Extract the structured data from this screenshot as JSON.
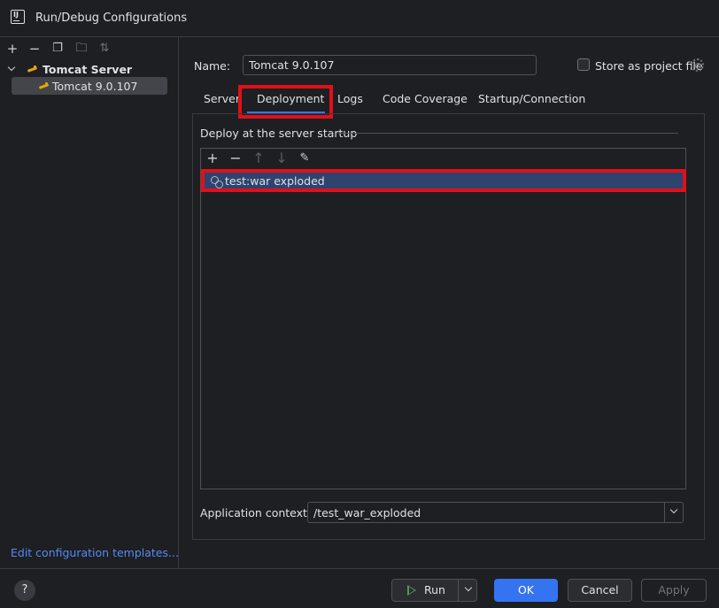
{
  "window": {
    "title": "Run/Debug Configurations",
    "icon": "intellij-app-icon"
  },
  "sidebar": {
    "toolbar": [
      {
        "icon": "plus-icon",
        "glyph": "+"
      },
      {
        "icon": "minus-icon",
        "glyph": "−"
      },
      {
        "icon": "copy-icon",
        "glyph": "❐"
      },
      {
        "icon": "folder-add-icon",
        "glyph": "🗀"
      },
      {
        "icon": "sort-icon",
        "glyph": "⇅"
      }
    ],
    "group_label": "Tomcat Server",
    "item_label": "Tomcat 9.0.107",
    "edit_templates_link": "Edit configuration templates..."
  },
  "form": {
    "name_label": "Name:",
    "name_value": "Tomcat 9.0.107",
    "store_label": "Store as project file",
    "store_checked": false
  },
  "tabs": [
    {
      "label": "Server",
      "active": false
    },
    {
      "label": "Deployment",
      "active": true
    },
    {
      "label": "Logs",
      "active": false
    },
    {
      "label": "Code Coverage",
      "active": false
    },
    {
      "label": "Startup/Connection",
      "active": false
    }
  ],
  "deployment": {
    "section_title": "Deploy at the server startup",
    "list_toolbar": [
      {
        "icon": "plus-icon",
        "glyph": "+",
        "enabled": true
      },
      {
        "icon": "minus-icon",
        "glyph": "−",
        "enabled": true
      },
      {
        "icon": "move-up-icon",
        "glyph": "↑",
        "enabled": false
      },
      {
        "icon": "move-down-icon",
        "glyph": "↓",
        "enabled": false
      },
      {
        "icon": "edit-icon",
        "glyph": "✎",
        "enabled": true
      }
    ],
    "artifacts": [
      "test:war exploded"
    ],
    "app_context_label": "Application context:",
    "app_context_value": "/test_war_exploded"
  },
  "footer": {
    "help": "?",
    "run": "Run",
    "ok": "OK",
    "cancel": "Cancel",
    "apply": "Apply"
  },
  "colors": {
    "background": "#1e1f22",
    "accent": "#3574f0",
    "highlight_box": "#e0101b",
    "selection": "#2e436e",
    "link": "#548af7"
  }
}
